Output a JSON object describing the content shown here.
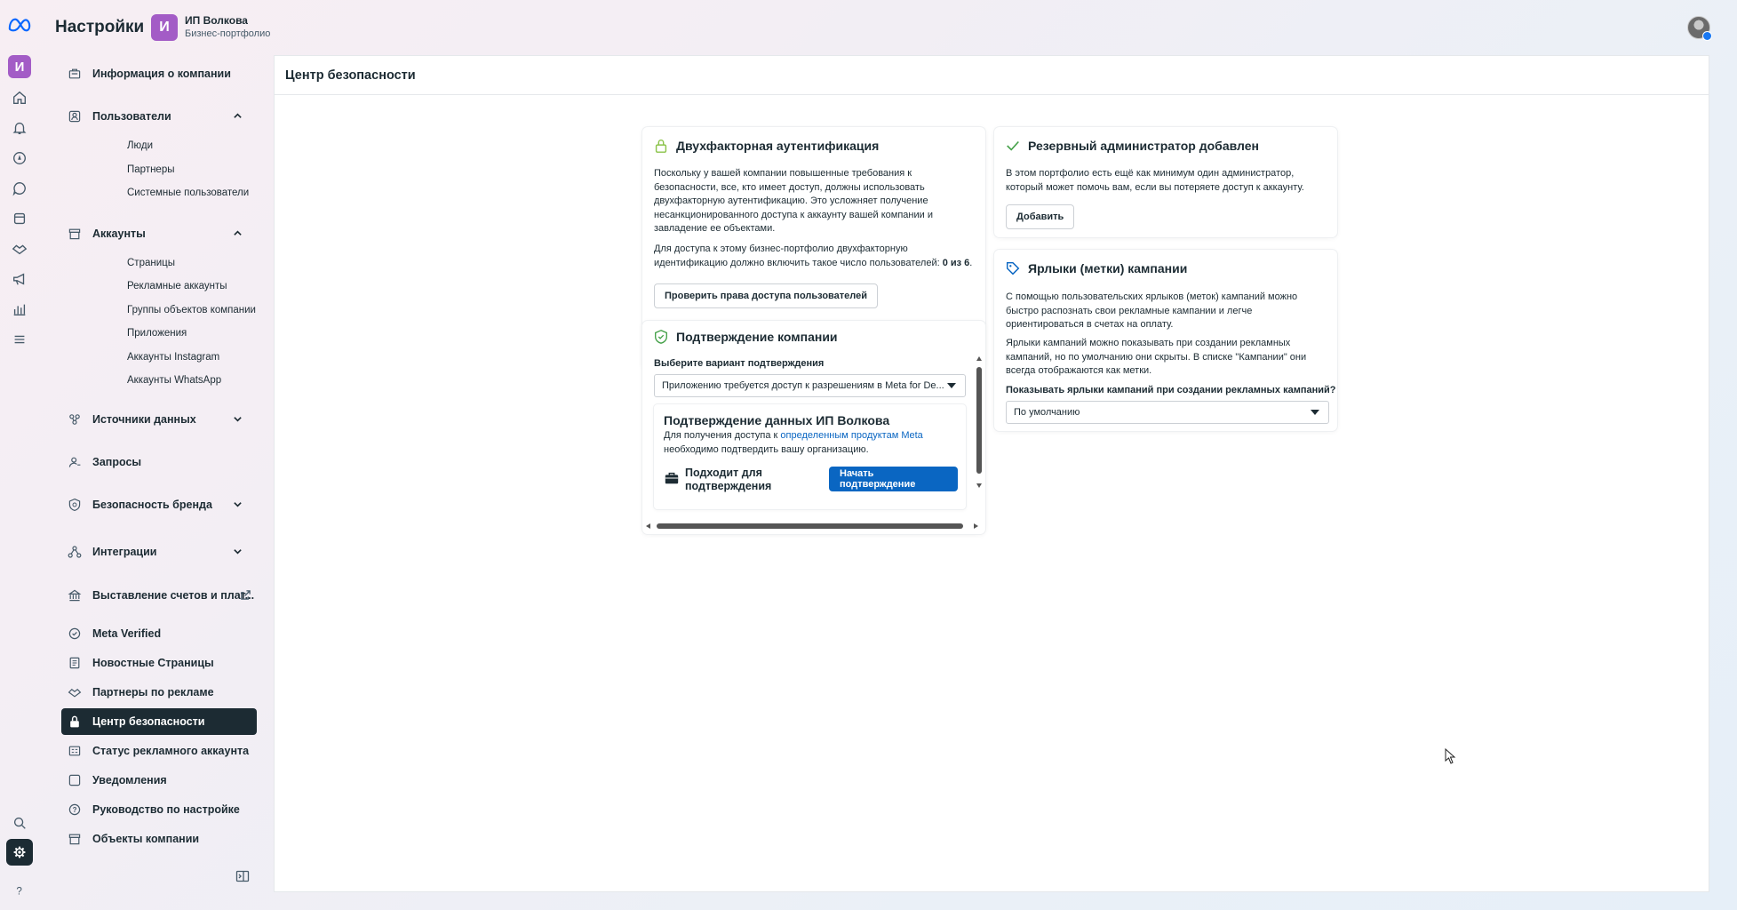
{
  "header": {
    "app_title": "Настройки",
    "portfolio_initial": "И",
    "portfolio_name": "ИП Волкова",
    "portfolio_type": "Бизнес-портфолио"
  },
  "rail": {
    "avatar_initial": "И",
    "icons": [
      "meta-logo-icon",
      "home-icon",
      "bell-icon",
      "compass-icon",
      "chat-icon",
      "pages-icon",
      "handshake-icon",
      "megaphone-icon",
      "bar-chart-icon",
      "menu-icon",
      "search-icon",
      "gear-icon",
      "help-icon"
    ]
  },
  "sidebar": {
    "company_info": "Информация о компании",
    "users": "Пользователи",
    "users_sub": [
      "Люди",
      "Партнеры",
      "Системные пользователи"
    ],
    "accounts": "Аккаунты",
    "accounts_sub": [
      "Страницы",
      "Рекламные аккаунты",
      "Группы объектов компании",
      "Приложения",
      "Аккаунты Instagram",
      "Аккаунты WhatsApp"
    ],
    "data_sources": "Источники данных",
    "requests": "Запросы",
    "brand_safety": "Безопасность бренда",
    "integrations": "Интеграции",
    "billing": "Выставление счетов и плат...",
    "meta_verified": "Meta Verified",
    "news_pages": "Новостные Страницы",
    "ad_partners": "Партнеры по рекламе",
    "security_center": "Центр безопасности",
    "ad_account_status": "Статус рекламного аккаунта",
    "notifications": "Уведомления",
    "setup_guide": "Руководство по настройке",
    "company_objects": "Объекты компании"
  },
  "main": {
    "title": "Центр безопасности",
    "two_factor": {
      "title": "Двухфакторная аутентификация",
      "text1": "Поскольку у вашей компании повышенные требования к безопасности, все, кто имеет доступ, должны использовать двухфакторную аутентификацию. Это усложняет получение несанкционированного доступа к аккаунту вашей компании и завладение ее объектами.",
      "text2_prefix": "Для доступа к этому бизнес-портфолио двухфакторную идентификацию должно включить такое число пользователей: ",
      "text2_count": "0 из 6",
      "text2_suffix": ".",
      "button": "Проверить права доступа пользователей"
    },
    "backup_admin": {
      "title": "Резервный администратор добавлен",
      "text": "В этом портфолио есть ещё как минимум один администратор, который может помочь вам, если вы потеряете доступ к аккаунту.",
      "button": "Добавить"
    },
    "verification": {
      "title": "Подтверждение компании",
      "select_label": "Выберите вариант подтверждения",
      "select_value": "Приложению требуется доступ к разрешениям в Meta for De...",
      "inner_title": "Подтверждение данных ИП Волкова",
      "inner_text_prefix": "Для получения доступа к ",
      "inner_link": "определенным продуктам Meta",
      "inner_text_suffix": "необходимо подтвердить вашу организацию.",
      "eligible": "Подходит для подтверждения",
      "start_button": "Начать подтверждение"
    },
    "labels": {
      "title": "Ярлыки (метки) кампании",
      "text1": "С помощью пользовательских ярлыков (меток) кампаний можно быстро распознать свои рекламные кампании и легче ориентироваться в счетах на оплату.",
      "text2": "Ярлыки кампаний можно показывать при создании рекламных кампаний, но по умолчанию они скрыты. В списке \"Кампании\" они всегда отображаются как метки.",
      "question": "Показывать ярлыки кампаний при создании рекламных кампаний?",
      "select_value": "По умолчанию"
    }
  },
  "colors": {
    "brand_purple": "#a35cc6",
    "active_nav": "#1c2b33",
    "primary_button": "#0a66c2",
    "link": "#0a66c2"
  }
}
